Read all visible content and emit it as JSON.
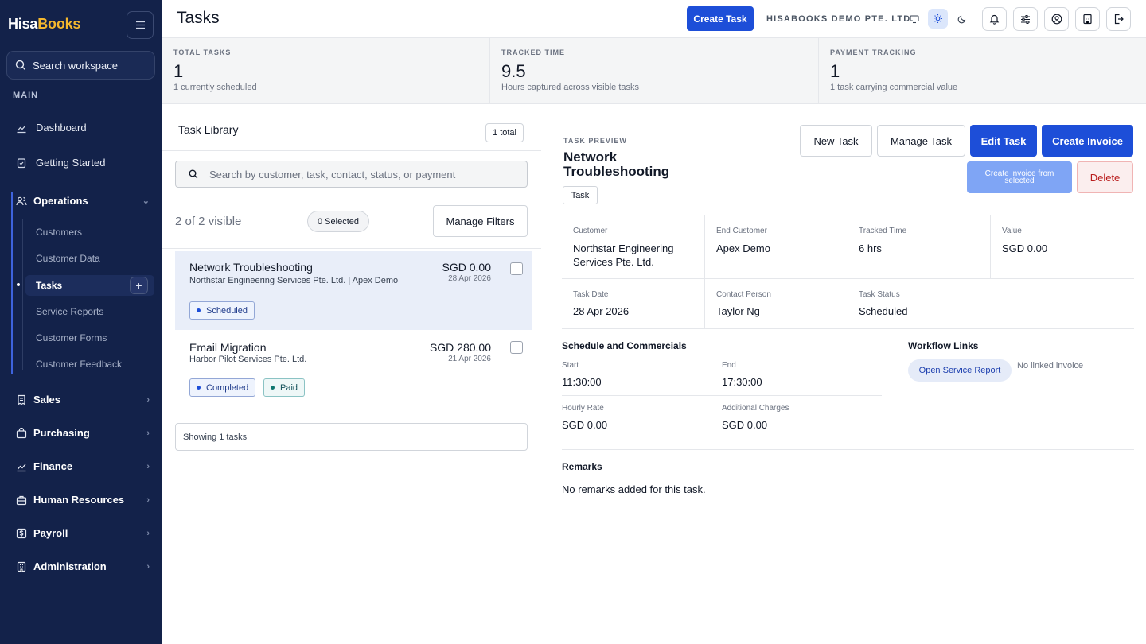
{
  "brand": {
    "part1": "Hisa",
    "part2": "Books"
  },
  "sidebar": {
    "search_placeholder": "Search workspace",
    "main_label": "MAIN",
    "dashboard": "Dashboard",
    "getting_started": "Getting Started",
    "operations": {
      "label": "Operations",
      "items": [
        "Customers",
        "Customer Data",
        "Tasks",
        "Service Reports",
        "Customer Forms",
        "Customer Feedback"
      ],
      "active": "Tasks"
    },
    "groups": [
      "Sales",
      "Purchasing",
      "Finance",
      "Human Resources",
      "Payroll",
      "Administration"
    ]
  },
  "header": {
    "title": "Tasks",
    "create_task": "Create Task",
    "company": "HISABOOKS DEMO PTE. LTD."
  },
  "stats": [
    {
      "label": "TOTAL TASKS",
      "value": "1",
      "sub": "1 currently scheduled"
    },
    {
      "label": "TRACKED TIME",
      "value": "9.5",
      "sub": "Hours captured across visible tasks"
    },
    {
      "label": "PAYMENT TRACKING",
      "value": "1",
      "sub": "1 task carrying commercial value"
    }
  ],
  "library": {
    "title": "Task Library",
    "count": "1 total",
    "search_placeholder": "Search by customer, task, contact, status, or payment",
    "visible": "2 of 2 visible",
    "selected": "0 Selected",
    "manage_filters": "Manage Filters",
    "tasks": [
      {
        "name": "Network Troubleshooting",
        "customer": "Northstar Engineering Services Pte. Ltd. | Apex Demo",
        "amount": "SGD 0.00",
        "date": "28 Apr 2026",
        "badges": [
          "Scheduled"
        ]
      },
      {
        "name": "Email Migration",
        "customer": "Harbor Pilot Services Pte. Ltd.",
        "amount": "SGD 280.00",
        "date": "21 Apr 2026",
        "badges": [
          "Completed",
          "Paid"
        ]
      }
    ],
    "showing": "Showing 1 tasks"
  },
  "preview": {
    "kicker": "TASK PREVIEW",
    "title": "Network Troubleshooting",
    "tag": "Task",
    "buttons": {
      "new": "New Task",
      "manage": "Manage Task",
      "edit": "Edit Task",
      "create_invoice": "Create Invoice",
      "invoice_from_selected": "Create invoice from selected",
      "delete": "Delete"
    },
    "fields": {
      "customer": {
        "label": "Customer",
        "value": "Northstar Engineering Services Pte. Ltd."
      },
      "end_customer": {
        "label": "End Customer",
        "value": "Apex Demo"
      },
      "tracked_time": {
        "label": "Tracked Time",
        "value": "6 hrs"
      },
      "value": {
        "label": "Value",
        "value": "SGD 0.00"
      },
      "task_date": {
        "label": "Task Date",
        "value": "28 Apr 2026"
      },
      "contact": {
        "label": "Contact Person",
        "value": "Taylor Ng"
      },
      "status": {
        "label": "Task Status",
        "value": "Scheduled"
      }
    },
    "schedule": {
      "title": "Schedule and Commercials",
      "start": {
        "label": "Start",
        "value": "11:30:00"
      },
      "end": {
        "label": "End",
        "value": "17:30:00"
      },
      "rate": {
        "label": "Hourly Rate",
        "value": "SGD 0.00"
      },
      "charges": {
        "label": "Additional Charges",
        "value": "SGD 0.00"
      }
    },
    "workflow": {
      "title": "Workflow Links",
      "open_report": "Open Service Report",
      "no_invoice": "No linked invoice"
    },
    "remarks": {
      "title": "Remarks",
      "text": "No remarks added for this task."
    }
  }
}
